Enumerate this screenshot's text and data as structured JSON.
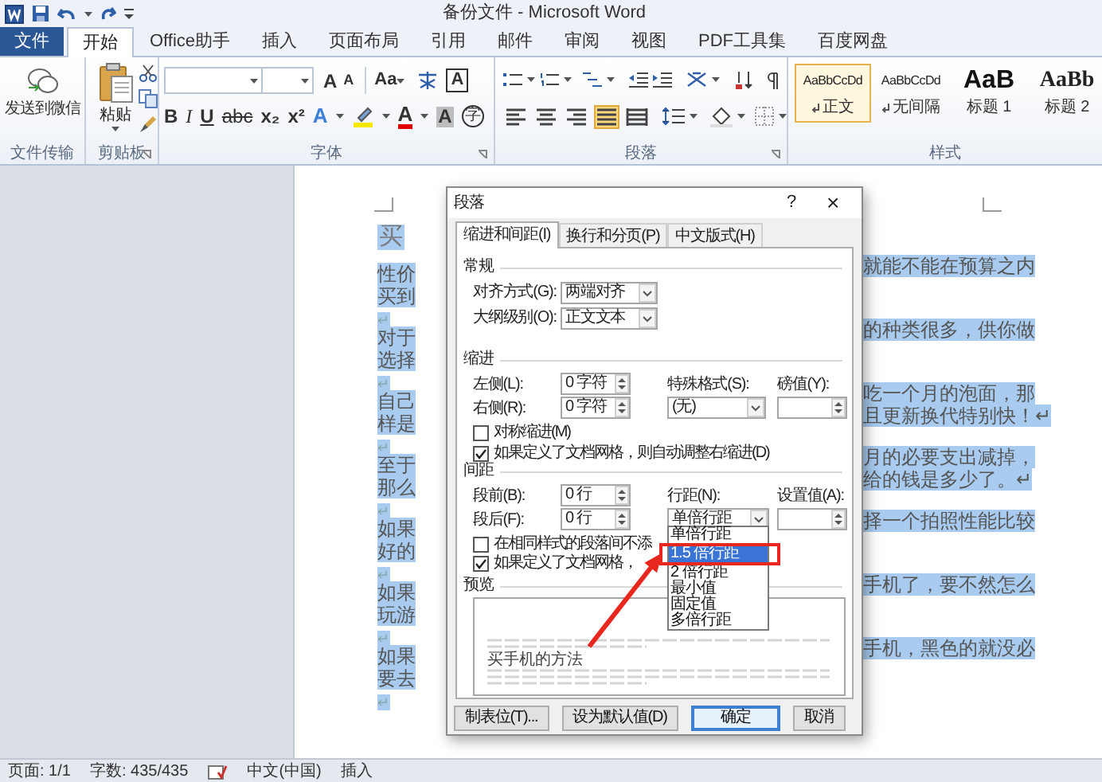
{
  "title_bar": {
    "title": "备份文件 - Microsoft Word"
  },
  "tabs": [
    {
      "label": "文件",
      "kind": "file",
      "selected": false
    },
    {
      "label": "开始",
      "kind": "tab",
      "selected": true
    },
    {
      "label": "Office助手",
      "kind": "tab",
      "selected": false
    },
    {
      "label": "插入",
      "kind": "tab",
      "selected": false
    },
    {
      "label": "页面布局",
      "kind": "tab",
      "selected": false
    },
    {
      "label": "引用",
      "kind": "tab",
      "selected": false
    },
    {
      "label": "邮件",
      "kind": "tab",
      "selected": false
    },
    {
      "label": "审阅",
      "kind": "tab",
      "selected": false
    },
    {
      "label": "视图",
      "kind": "tab",
      "selected": false
    },
    {
      "label": "PDF工具集",
      "kind": "tab",
      "selected": false
    },
    {
      "label": "百度网盘",
      "kind": "tab",
      "selected": false
    }
  ],
  "ribbon": {
    "transfer": {
      "button": "发送到微信",
      "label": "文件传输"
    },
    "clipboard": {
      "paste": "粘贴",
      "label": "剪贴板"
    },
    "font": {
      "label": "字体",
      "grow": "A",
      "shrink": "A",
      "case": "Aa",
      "border": "A",
      "format_buttons": [
        {
          "label": "B",
          "kind": "bold"
        },
        {
          "label": "I",
          "kind": "italic"
        },
        {
          "label": "U",
          "kind": "underline"
        },
        {
          "label": "abc",
          "kind": "strike"
        },
        {
          "label": "x₂",
          "kind": "sub"
        },
        {
          "label": "x²",
          "kind": "sup"
        }
      ],
      "color_buttons": [
        {
          "label": "A",
          "kind": "effect"
        },
        {
          "kind": "highlight"
        },
        {
          "label": "A",
          "kind": "font-color"
        },
        {
          "label": "A",
          "kind": "shading"
        },
        {
          "label": "字",
          "kind": "enclose"
        }
      ]
    },
    "paragraph": {
      "label": "段落",
      "alignments": [
        {
          "kind": "left",
          "selected": false
        },
        {
          "kind": "center",
          "selected": false
        },
        {
          "kind": "right",
          "selected": false
        },
        {
          "kind": "justify",
          "selected": true
        },
        {
          "kind": "distributed",
          "selected": false
        }
      ]
    },
    "styles": {
      "label": "样式",
      "items": [
        {
          "preview": "AaBbCcDd",
          "name": "正文",
          "kind": "normal",
          "selected": true
        },
        {
          "preview": "AaBbCcDd",
          "name": "无间隔",
          "kind": "normal",
          "selected": false
        },
        {
          "preview": "AaB",
          "name": "标题 1",
          "kind": "heading1",
          "selected": false
        },
        {
          "preview": "AaBb",
          "name": "标题 2",
          "kind": "heading2",
          "selected": false
        }
      ]
    }
  },
  "document": {
    "heading": "买",
    "lines": [
      {
        "kind": "text",
        "left": "性价",
        "right": "就能不能在预算之内"
      },
      {
        "kind": "text",
        "left": "买到"
      },
      {
        "kind": "blank",
        "left": "↵"
      },
      {
        "kind": "text",
        "left": "对于",
        "right": "的种类很多，供你做"
      },
      {
        "kind": "text",
        "left": "选择"
      },
      {
        "kind": "blank",
        "left": "↵"
      },
      {
        "kind": "text",
        "left": "自己",
        "right": "吃一个月的泡面，那"
      },
      {
        "kind": "text",
        "left": "样是",
        "right": "且更新换代特别快！↵"
      },
      {
        "kind": "blank",
        "left": "↵"
      },
      {
        "kind": "text",
        "left": "至于",
        "right": "月的必要支出减掉，"
      },
      {
        "kind": "text",
        "left": "那么",
        "right": "给的钱是多少了。↵"
      },
      {
        "kind": "blank",
        "left": "↵"
      },
      {
        "kind": "text",
        "left": "如果",
        "right": "择一个拍照性能比较"
      },
      {
        "kind": "text",
        "left": "好的"
      },
      {
        "kind": "blank",
        "left": "↵"
      },
      {
        "kind": "text",
        "left": "如果",
        "right": "手机了，要不然怎么"
      },
      {
        "kind": "text",
        "left": "玩游"
      },
      {
        "kind": "blank",
        "left": "↵"
      },
      {
        "kind": "text",
        "left": "如果",
        "right": "手机，黑色的就没必"
      },
      {
        "kind": "text",
        "left": "要去"
      },
      {
        "kind": "blank",
        "left": "↵"
      }
    ]
  },
  "dialog": {
    "title": "段落",
    "help": "?",
    "close": "×",
    "tabs": [
      {
        "label": "缩进和间距(I)",
        "selected": true
      },
      {
        "label": "换行和分页(P)",
        "selected": false
      },
      {
        "label": "中文版式(H)",
        "selected": false
      }
    ],
    "general": {
      "heading": "常规",
      "alignment": {
        "label": "对齐方式(G):",
        "value": "两端对齐"
      },
      "outline": {
        "label": "大纲级别(O):",
        "value": "正文文本"
      }
    },
    "indent": {
      "heading": "缩进",
      "left": {
        "label": "左侧(L):",
        "value": "0 字符"
      },
      "right": {
        "label": "右侧(R):",
        "value": "0 字符"
      },
      "special": {
        "label": "特殊格式(S):",
        "value": "(无)"
      },
      "by": {
        "label": "磅值(Y):"
      },
      "checks": [
        {
          "label": "对称缩进(M)",
          "checked": false
        },
        {
          "label": "如果定义了文档网格，则自动调整右缩进(D)",
          "checked": true
        }
      ]
    },
    "spacing": {
      "heading": "间距",
      "before": {
        "label": "段前(B):",
        "value": "0 行"
      },
      "after": {
        "label": "段后(F):",
        "value": "0 行"
      },
      "line": {
        "label": "行距(N):",
        "value": "单倍行距"
      },
      "at": {
        "label": "设置值(A):"
      },
      "checks": [
        {
          "label": "在相同样式的段落间不添",
          "checked": false
        },
        {
          "label": "如果定义了文档网格，",
          "checked": true
        }
      ]
    },
    "line_spacing_menu": [
      {
        "label": "单倍行距",
        "selected": false
      },
      {
        "label": "1.5 倍行距",
        "selected": true
      },
      {
        "label": "2 倍行距",
        "selected": false
      },
      {
        "label": "最小值",
        "selected": false
      },
      {
        "label": "固定值",
        "selected": false
      },
      {
        "label": "多倍行距",
        "selected": false
      }
    ],
    "preview": {
      "heading": "预览",
      "sample": "买手机的方法"
    },
    "buttons": [
      {
        "label": "制表位(T)...",
        "kind": "normal"
      },
      {
        "label": "设为默认值(D)",
        "kind": "normal"
      },
      {
        "label": "确定",
        "kind": "default"
      },
      {
        "label": "取消",
        "kind": "normal"
      }
    ]
  },
  "status_bar": [
    "页面: 1/1",
    "字数: 435/435",
    "中文(中国)",
    "插入"
  ]
}
